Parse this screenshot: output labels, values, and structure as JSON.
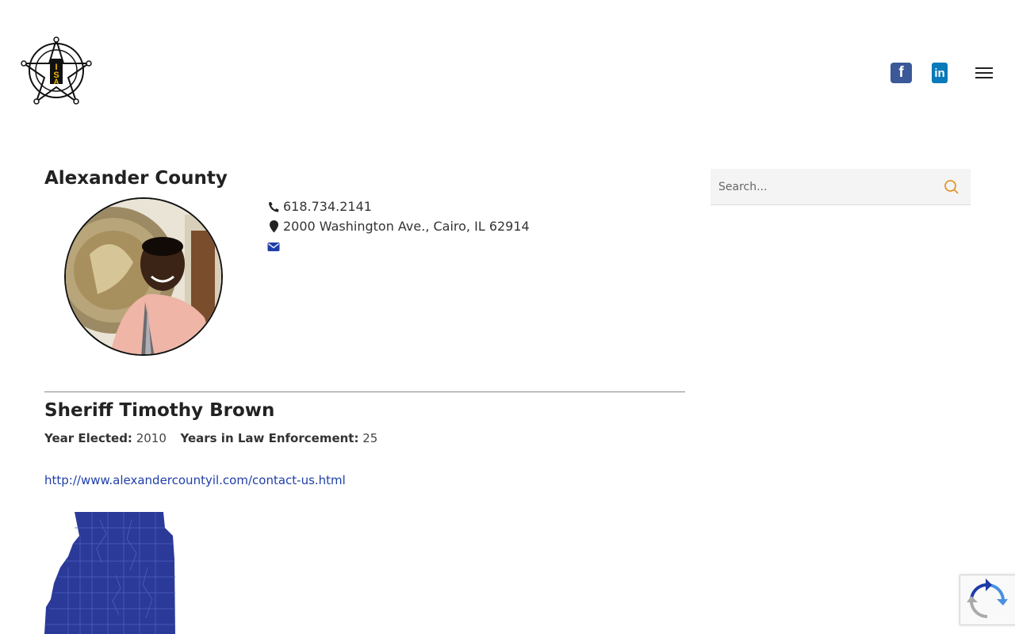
{
  "header": {
    "logo_icon": "illinois-sheriffs-association-logo",
    "social": [
      {
        "name": "facebook",
        "icon": "facebook-icon",
        "glyph": "f",
        "color": "#3b5998"
      },
      {
        "name": "linkedin",
        "icon": "linkedin-icon",
        "glyph": "in",
        "color": "#0a7ab8"
      }
    ],
    "menu_icon": "hamburger-menu-icon"
  },
  "county": {
    "title": "Alexander County",
    "phone": "618.734.2141",
    "address": "2000 Washington Ave., Cairo, IL 62914",
    "icons": {
      "phone": "phone-icon",
      "address": "map-marker-icon",
      "email": "envelope-icon"
    }
  },
  "sheriff": {
    "name": "Sheriff Timothy Brown",
    "year_elected_label": "Year Elected:",
    "year_elected": "2010",
    "years_le_label": "Years in Law Enforcement:",
    "years_le": "25",
    "website": "http://www.alexandercountyil.com/contact-us.html"
  },
  "sidebar": {
    "search_placeholder": "Search..."
  },
  "colors": {
    "accent_link": "#1f3fa8",
    "map_fill": "#2b3a99",
    "search_icon": "#e0962c"
  }
}
